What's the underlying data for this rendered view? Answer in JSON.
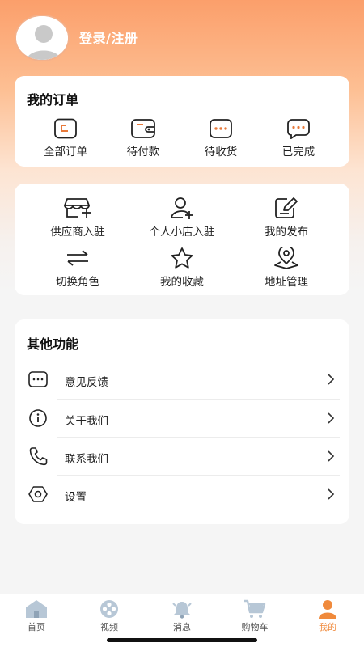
{
  "header": {
    "login_label": "登录/注册"
  },
  "orders": {
    "title": "我的订单",
    "items": [
      {
        "label": "全部订单",
        "icon": "all-orders-icon"
      },
      {
        "label": "待付款",
        "icon": "wallet-icon"
      },
      {
        "label": "待收货",
        "icon": "pending-receipt-icon"
      },
      {
        "label": "已完成",
        "icon": "completed-icon"
      }
    ]
  },
  "services": {
    "items": [
      {
        "label": "供应商入驻",
        "icon": "supplier-store-icon"
      },
      {
        "label": "个人小店入驻",
        "icon": "add-user-icon"
      },
      {
        "label": "我的发布",
        "icon": "edit-icon"
      },
      {
        "label": "切换角色",
        "icon": "switch-arrows-icon"
      },
      {
        "label": "我的收藏",
        "icon": "star-icon"
      },
      {
        "label": "地址管理",
        "icon": "location-pin-icon"
      }
    ]
  },
  "other": {
    "title": "其他功能",
    "items": [
      {
        "label": "意见反馈",
        "icon": "feedback-icon"
      },
      {
        "label": "关于我们",
        "icon": "info-icon"
      },
      {
        "label": "联系我们",
        "icon": "phone-icon"
      },
      {
        "label": "设置",
        "icon": "settings-icon"
      }
    ]
  },
  "tabbar": {
    "items": [
      {
        "label": "首页",
        "icon": "home-icon"
      },
      {
        "label": "视频",
        "icon": "video-reel-icon"
      },
      {
        "label": "消息",
        "icon": "bell-icon"
      },
      {
        "label": "购物车",
        "icon": "cart-icon"
      },
      {
        "label": "我的",
        "icon": "profile-icon"
      }
    ],
    "active": "我的"
  },
  "colors": {
    "accent": "#f08a3c",
    "icon_orange": "#e8793a",
    "header_gradient_top": "#fb9f6b"
  }
}
